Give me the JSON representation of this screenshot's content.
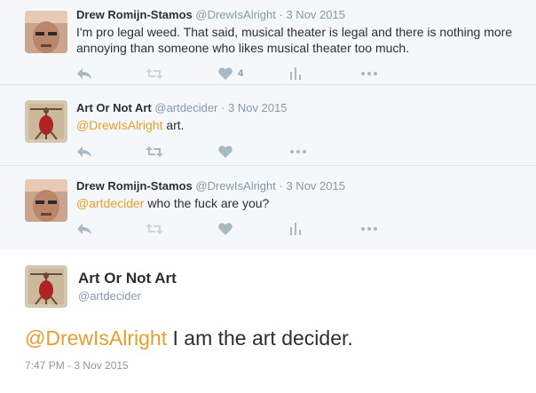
{
  "tweets": [
    {
      "fullname": "Drew Romijn-Stamos",
      "handle": "@DrewIsAlright",
      "dot": "·",
      "time": "3 Nov 2015",
      "mention": "",
      "text": "I'm pro legal weed. That said, musical theater is legal and there is nothing more annoying than someone who likes musical theater too much.",
      "likes": "4"
    },
    {
      "fullname": "Art Or Not Art",
      "handle": "@artdecider",
      "dot": "·",
      "time": "3 Nov 2015",
      "mention": "@DrewIsAlright",
      "text": " art.",
      "likes": ""
    },
    {
      "fullname": "Drew Romijn-Stamos",
      "handle": "@DrewIsAlright",
      "dot": "·",
      "time": "3 Nov 2015",
      "mention": "@artdecider",
      "text": " who the fuck are you?",
      "likes": ""
    }
  ],
  "main": {
    "fullname": "Art Or Not Art",
    "handle": "@artdecider",
    "mention": "@DrewIsAlright",
    "text": " I am the art decider.",
    "timestamp": "7:47 PM - 3 Nov 2015"
  },
  "icons": {
    "reply": "reply-icon",
    "retweet": "retweet-icon",
    "like": "heart-icon",
    "analytics": "analytics-icon",
    "more": "more-icon"
  },
  "colors": {
    "mention": "#e79e2b",
    "muted": "#8899a6",
    "icon": "#aab8c2",
    "retweet_disabled": "#ccd6dd",
    "thread_bg": "#f5f8fa"
  }
}
